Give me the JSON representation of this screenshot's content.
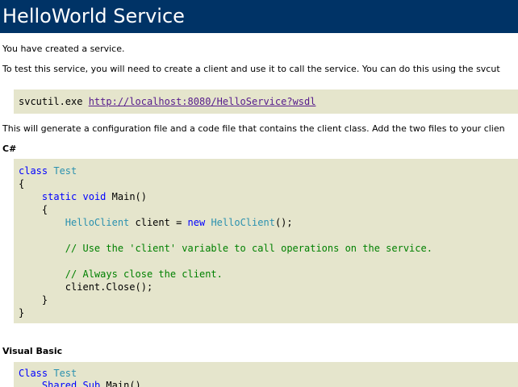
{
  "header": {
    "title": "HelloWorld Service"
  },
  "intro": {
    "line1": "You have created a service.",
    "line2": "To test this service, you will need to create a client and use it to call the service. You can do this using the svcut",
    "line3": "This will generate a configuration file and a code file that contains the client class. Add the two files to your clien"
  },
  "svcutil": {
    "command": "svcutil.exe ",
    "url": "http://localhost:8080/HelloService?wsdl"
  },
  "csharp": {
    "label": "C#",
    "kw_class": "class",
    "type_test": "Test",
    "open_brace_1": "{",
    "kw_static": "static",
    "kw_void": "void",
    "main": "Main()",
    "open_brace_2": "{",
    "type_helloclient_1": "HelloClient",
    "client_assign": " client = ",
    "kw_new": "new",
    "type_helloclient_2": "HelloClient",
    "ctor_end": "();",
    "comment_1": "// Use the 'client' variable to call operations on the service.",
    "comment_2": "// Always close the client.",
    "close_call": "client.Close();",
    "close_brace_2": "}",
    "close_brace_1": "}"
  },
  "vb": {
    "label": "Visual Basic",
    "kw_class": "Class",
    "type_test": "Test",
    "kw_shared": "Shared",
    "kw_sub": "Sub",
    "main": "Main()"
  },
  "colors": {
    "header_bg": "#003366",
    "code_bg": "#e5e5cc",
    "keyword": "#0000ff",
    "type": "#2b91af",
    "comment": "#008000",
    "link": "#551a8b"
  }
}
